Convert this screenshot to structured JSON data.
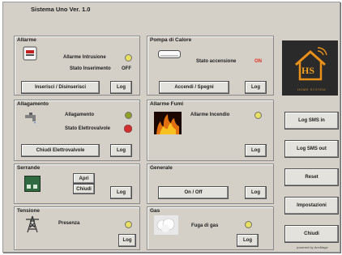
{
  "window": {
    "title": "Sistema Uno Ver. 1.0"
  },
  "panels": {
    "allarme": {
      "title": "Allarme",
      "lbl_allarme": "Allarme Intrusione",
      "lbl_stato": "Stato Inserimento",
      "val_stato": "OFF",
      "btn_toggle": "Inserisci / Disinserisci",
      "btn_log": "Log",
      "led_color": "#e8e060"
    },
    "pompa": {
      "title": "Pompa di Calore",
      "lbl_stato": "Stato accensione",
      "val_stato": "ON",
      "val_color": "#e03020",
      "btn_toggle": "Accendi / Spegni",
      "btn_log": "Log"
    },
    "allagamento": {
      "title": "Allagamento",
      "lbl_allagamento": "Allagamento",
      "lbl_elettro": "Stato Elettrovalvole",
      "btn_toggle": "Chiudi Elettrovalvole",
      "btn_log": "Log",
      "led1_color": "#90a020",
      "led2_color": "#d03030"
    },
    "fumi": {
      "title": "Allarme Fumi",
      "lbl_incendio": "Allarme Incendio",
      "btn_log": "Log",
      "led_color": "#e8e060"
    },
    "serrande": {
      "title": "Serrande",
      "btn_apri": "Apri",
      "btn_chiudi": "Chiudi",
      "btn_log": "Log"
    },
    "generale": {
      "title": "Generale",
      "btn_onoff": "On / Off",
      "btn_log": "Log"
    },
    "tensione": {
      "title": "Tensione",
      "lbl_presenza": "Presenza",
      "btn_log": "Log",
      "led_color": "#e8e060"
    },
    "gas": {
      "title": "Gas",
      "lbl_fuga": "Fuga di gas",
      "btn_log": "Log",
      "led_color": "#e8e060"
    }
  },
  "sidebar": {
    "logo_text": "HS",
    "logo_sub": "HOME SYSTEM",
    "buttons": [
      "Log SMS in",
      "Log SMS out",
      "Reset",
      "Impostazioni",
      "Chiudi"
    ]
  },
  "footer": "powered by AnnMage"
}
